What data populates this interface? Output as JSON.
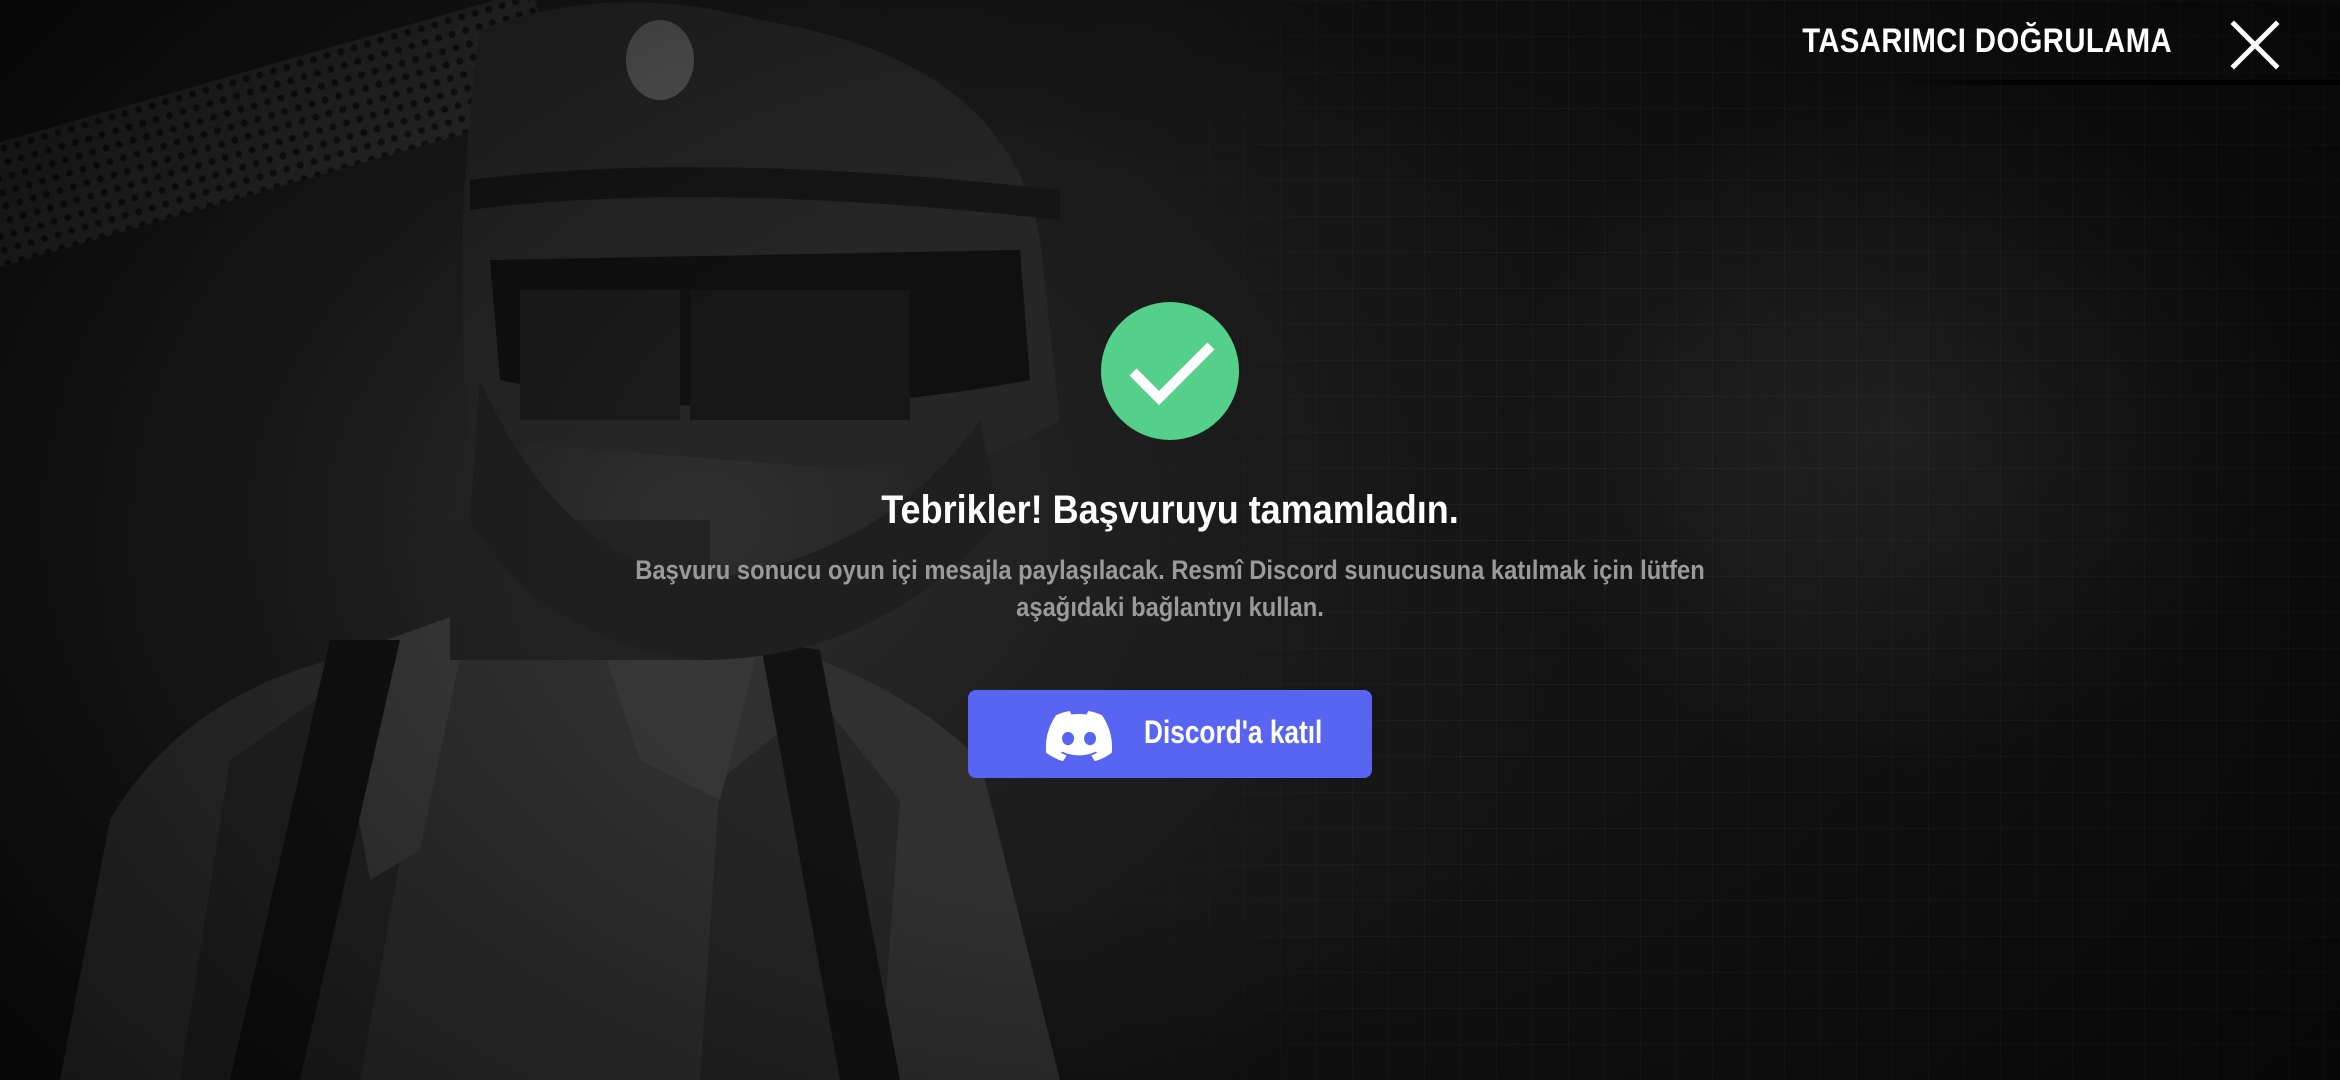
{
  "header": {
    "title": "TASARIMCI DOĞRULAMA",
    "close_icon": "close-icon"
  },
  "main": {
    "status_icon": "check-icon",
    "headline": "Tebrikler! Başvuruyu tamamladın.",
    "description": "Başvuru sonucu oyun içi mesajla paylaşılacak. Resmî Discord sunucusuna katılmak için lütfen aşağıdaki bağlantıyı kullan.",
    "discord_button": {
      "label": "Discord'a katıl",
      "icon": "discord-icon"
    }
  },
  "colors": {
    "success": "#55d08a",
    "discord": "#5865f2",
    "text_primary": "#ffffff",
    "text_secondary": "#9a9a9a"
  }
}
